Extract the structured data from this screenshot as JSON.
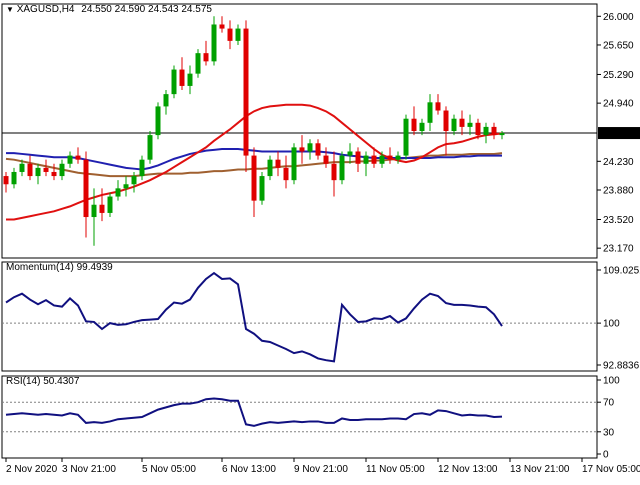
{
  "title": {
    "symbol": "XAGUSD,H4",
    "ohlc": "24.550 24.590 24.543 24.575"
  },
  "colors": {
    "background": "#ffffff",
    "bull": "#00a000",
    "bear": "#e00000",
    "ma_fast": "#e01010",
    "ma_mid": "#2020b0",
    "ma_slow": "#a06030",
    "indicator": "#101080",
    "grid": "#808080"
  },
  "chart_data": [
    {
      "type": "candlestick",
      "pane": "price",
      "ylim": [
        23.05,
        26.15
      ],
      "price_ticks": [
        "26.000",
        "25.650",
        "25.290",
        "24.940",
        "24.575",
        "24.230",
        "23.880",
        "23.520",
        "23.170"
      ],
      "current_price": "24.575",
      "current_price_value": 24.575,
      "candles": [
        [
          24.05,
          24.1,
          23.85,
          23.95
        ],
        [
          23.95,
          24.15,
          23.9,
          24.1
        ],
        [
          24.1,
          24.25,
          24.05,
          24.2
        ],
        [
          24.2,
          24.3,
          24.0,
          24.05
        ],
        [
          24.05,
          24.2,
          23.95,
          24.15
        ],
        [
          24.15,
          24.25,
          24.05,
          24.1
        ],
        [
          24.1,
          24.2,
          24.0,
          24.05
        ],
        [
          24.05,
          24.25,
          24.0,
          24.2
        ],
        [
          24.2,
          24.35,
          24.15,
          24.3
        ],
        [
          24.3,
          24.4,
          24.2,
          24.25
        ],
        [
          24.25,
          24.35,
          23.3,
          23.55
        ],
        [
          23.55,
          23.9,
          23.2,
          23.7
        ],
        [
          23.7,
          23.9,
          23.5,
          23.6
        ],
        [
          23.6,
          23.85,
          23.55,
          23.8
        ],
        [
          23.8,
          24.0,
          23.75,
          23.9
        ],
        [
          23.9,
          24.05,
          23.8,
          23.95
        ],
        [
          23.95,
          24.1,
          23.85,
          24.05
        ],
        [
          24.05,
          24.3,
          24.0,
          24.25
        ],
        [
          24.25,
          24.6,
          24.2,
          24.55
        ],
        [
          24.55,
          24.95,
          24.5,
          24.9
        ],
        [
          24.9,
          25.1,
          24.8,
          25.05
        ],
        [
          25.05,
          25.4,
          25.0,
          25.35
        ],
        [
          25.35,
          25.5,
          25.1,
          25.15
        ],
        [
          25.15,
          25.4,
          25.05,
          25.3
        ],
        [
          25.3,
          25.6,
          25.25,
          25.55
        ],
        [
          25.55,
          25.7,
          25.4,
          25.45
        ],
        [
          25.45,
          26.0,
          25.4,
          25.9
        ],
        [
          25.9,
          26.0,
          25.8,
          25.85
        ],
        [
          25.85,
          25.95,
          25.6,
          25.7
        ],
        [
          25.7,
          25.9,
          25.65,
          25.85
        ],
        [
          25.85,
          25.95,
          24.1,
          24.3
        ],
        [
          24.3,
          24.4,
          23.55,
          23.75
        ],
        [
          23.75,
          24.1,
          23.7,
          24.05
        ],
        [
          24.05,
          24.3,
          24.0,
          24.25
        ],
        [
          24.25,
          24.35,
          24.05,
          24.15
        ],
        [
          24.15,
          24.3,
          23.9,
          24.0
        ],
        [
          24.0,
          24.45,
          23.95,
          24.4
        ],
        [
          24.4,
          24.55,
          24.2,
          24.35
        ],
        [
          24.35,
          24.5,
          24.25,
          24.45
        ],
        [
          24.45,
          24.5,
          24.25,
          24.3
        ],
        [
          24.3,
          24.4,
          24.15,
          24.2
        ],
        [
          24.2,
          24.35,
          23.8,
          24.0
        ],
        [
          24.0,
          24.35,
          23.95,
          24.3
        ],
        [
          24.3,
          24.45,
          24.2,
          24.35
        ],
        [
          24.35,
          24.4,
          24.1,
          24.2
        ],
        [
          24.2,
          24.35,
          24.05,
          24.3
        ],
        [
          24.3,
          24.4,
          24.15,
          24.2
        ],
        [
          24.2,
          24.35,
          24.15,
          24.3
        ],
        [
          24.3,
          24.4,
          24.2,
          24.25
        ],
        [
          24.25,
          24.35,
          24.2,
          24.3
        ],
        [
          24.3,
          24.8,
          24.25,
          24.75
        ],
        [
          24.75,
          24.9,
          24.55,
          24.6
        ],
        [
          24.6,
          24.75,
          24.55,
          24.7
        ],
        [
          24.7,
          25.05,
          24.6,
          24.95
        ],
        [
          24.95,
          25.05,
          24.8,
          24.85
        ],
        [
          24.85,
          24.9,
          24.3,
          24.6
        ],
        [
          24.6,
          24.8,
          24.55,
          24.75
        ],
        [
          24.75,
          24.85,
          24.55,
          24.65
        ],
        [
          24.65,
          24.8,
          24.55,
          24.7
        ],
        [
          24.7,
          24.75,
          24.5,
          24.55
        ],
        [
          24.55,
          24.7,
          24.45,
          24.65
        ],
        [
          24.65,
          24.7,
          24.5,
          24.55
        ],
        [
          24.55,
          24.6,
          24.5,
          24.575
        ]
      ],
      "ma_fast": [
        23.52,
        23.52,
        23.54,
        23.56,
        23.58,
        23.6,
        23.62,
        23.65,
        23.68,
        23.72,
        23.76,
        23.79,
        23.82,
        23.84,
        23.86,
        23.89,
        23.92,
        23.96,
        24.0,
        24.05,
        24.1,
        24.16,
        24.22,
        24.28,
        24.34,
        24.4,
        24.48,
        24.55,
        24.62,
        24.7,
        24.78,
        24.84,
        24.88,
        24.9,
        24.91,
        24.92,
        24.92,
        24.92,
        24.91,
        24.88,
        24.84,
        24.78,
        24.7,
        24.62,
        24.54,
        24.46,
        24.38,
        24.31,
        24.27,
        24.24,
        24.22,
        24.24,
        24.28,
        24.34,
        24.4,
        24.44,
        24.45,
        24.47,
        24.5,
        24.53,
        24.55,
        24.56,
        24.57
      ],
      "ma_mid": [
        24.33,
        24.33,
        24.32,
        24.31,
        24.3,
        24.29,
        24.28,
        24.28,
        24.28,
        24.27,
        24.25,
        24.23,
        24.21,
        24.19,
        24.17,
        24.15,
        24.14,
        24.13,
        24.15,
        24.18,
        24.22,
        24.26,
        24.29,
        24.32,
        24.34,
        24.36,
        24.37,
        24.38,
        24.38,
        24.38,
        24.37,
        24.36,
        24.35,
        24.35,
        24.35,
        24.35,
        24.35,
        24.35,
        24.35,
        24.35,
        24.34,
        24.33,
        24.31,
        24.3,
        24.29,
        24.28,
        24.27,
        24.27,
        24.27,
        24.27,
        24.27,
        24.27,
        24.27,
        24.27,
        24.28,
        24.28,
        24.28,
        24.29,
        24.29,
        24.3,
        24.3,
        24.3,
        24.3
      ],
      "ma_slow": [
        24.26,
        24.25,
        24.23,
        24.21,
        24.19,
        24.17,
        24.15,
        24.13,
        24.11,
        24.09,
        24.08,
        24.07,
        24.06,
        24.05,
        24.05,
        24.05,
        24.05,
        24.06,
        24.07,
        24.08,
        24.08,
        24.08,
        24.08,
        24.09,
        24.09,
        24.1,
        24.11,
        24.11,
        24.12,
        24.13,
        24.13,
        24.14,
        24.14,
        24.15,
        24.16,
        24.17,
        24.17,
        24.18,
        24.19,
        24.2,
        24.21,
        24.22,
        24.22,
        24.22,
        24.23,
        24.23,
        24.24,
        24.24,
        24.25,
        24.26,
        24.27,
        24.28,
        24.29,
        24.3,
        24.3,
        24.31,
        24.31,
        24.31,
        24.32,
        24.32,
        24.32,
        24.32,
        24.33
      ]
    },
    {
      "type": "line",
      "pane": "momentum",
      "label": "Momentum(14) 99.4939",
      "ylim": [
        92.8836,
        109.0251
      ],
      "ticks": [
        {
          "value": 109.0251,
          "label": "109.0251"
        },
        {
          "value": 100,
          "label": "100"
        },
        {
          "value": 92.8836,
          "label": "92.8836"
        }
      ],
      "level": 100,
      "values": [
        103.5,
        104.4,
        105.0,
        104.0,
        103.2,
        103.9,
        103.0,
        102.8,
        104.2,
        103.0,
        100.3,
        100.2,
        99.0,
        100.0,
        99.7,
        99.8,
        100.2,
        100.5,
        100.6,
        100.7,
        102.3,
        103.5,
        103.3,
        104.0,
        106.0,
        107.5,
        108.5,
        107.5,
        107.6,
        106.6,
        99.0,
        98.2,
        97.0,
        96.8,
        96.2,
        95.6,
        94.9,
        95.2,
        94.7,
        94.0,
        93.7,
        93.5,
        103.1,
        101.5,
        100.2,
        100.3,
        100.8,
        100.7,
        101.2,
        100.1,
        100.8,
        102.5,
        104.0,
        105.0,
        104.6,
        103.4,
        103.1,
        103.1,
        103.0,
        102.8,
        102.7,
        101.5,
        99.5
      ]
    },
    {
      "type": "line",
      "pane": "rsi",
      "label": "RSI(14) 50.4307",
      "ylim": [
        0,
        100
      ],
      "ticks": [
        {
          "value": 100,
          "label": "100"
        },
        {
          "value": 70,
          "label": "70"
        },
        {
          "value": 30,
          "label": "30"
        },
        {
          "value": 0,
          "label": "0"
        }
      ],
      "levels": [
        70,
        30
      ],
      "values": [
        53,
        54,
        55,
        54,
        53,
        54,
        53,
        52,
        55,
        53,
        42,
        43,
        42,
        44,
        47,
        48,
        49,
        50,
        55,
        60,
        63,
        66,
        68,
        68,
        70,
        74,
        75,
        74,
        72,
        72,
        40,
        38,
        41,
        43,
        42,
        43,
        44,
        43,
        44,
        44,
        42,
        42,
        48,
        46,
        46,
        47,
        47,
        47,
        48,
        48,
        47,
        54,
        55,
        53,
        59,
        58,
        55,
        52,
        53,
        52,
        52,
        50,
        50.4307
      ]
    },
    {
      "type": "axis",
      "pane": "time",
      "x_labels": [
        {
          "index": 0,
          "label": "2 Nov 2020"
        },
        {
          "index": 7,
          "label": "3 Nov 21:00"
        },
        {
          "index": 17,
          "label": "5 Nov 05:00"
        },
        {
          "index": 27,
          "label": "6 Nov 13:00"
        },
        {
          "index": 36,
          "label": "9 Nov 21:00"
        },
        {
          "index": 45,
          "label": "11 Nov 05:00"
        },
        {
          "index": 54,
          "label": "12 Nov 13:00"
        },
        {
          "index": 63,
          "label": "13 Nov 21:00"
        },
        {
          "index": 72,
          "label": "17 Nov 05:00"
        }
      ]
    }
  ]
}
